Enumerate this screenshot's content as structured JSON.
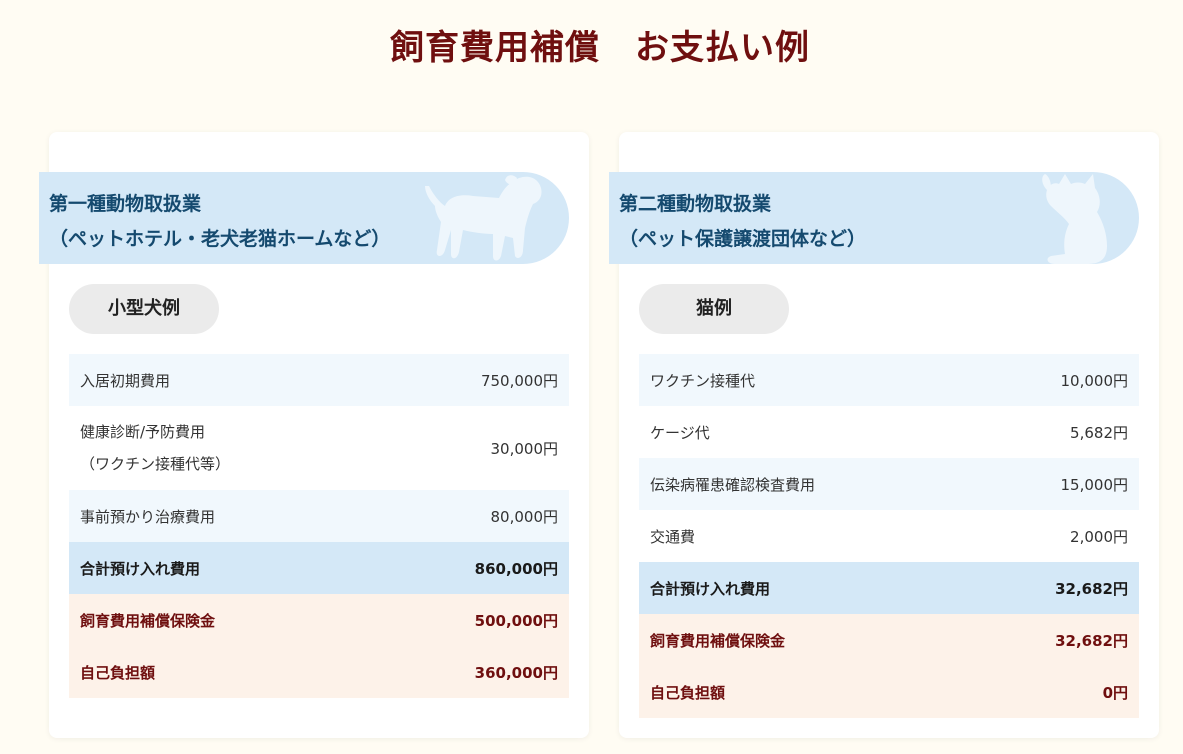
{
  "page": {
    "title": "飼育費用補償　お支払い例"
  },
  "colors": {
    "background": "#fffcf3",
    "title": "#6f0f0f",
    "banner": "#d4e8f7",
    "banner_text": "#154a6f",
    "row_alt": "#f1f8fd",
    "total_row": "#d4e8f7",
    "insured_row": "#fdf2e9"
  },
  "cards": [
    {
      "banner_line1": "第一種動物取扱業",
      "banner_line2": "（ペットホテル・老犬老猫ホームなど）",
      "banner_icon": "dog-silhouette-icon",
      "example_label": "小型犬例",
      "rows": [
        {
          "label": "入居初期費用",
          "value": "750,000円"
        },
        {
          "label": "健康診断/予防費用",
          "label2": "（ワクチン接種代等）",
          "value": "30,000円"
        },
        {
          "label": "事前預かり治療費用",
          "value": "80,000円"
        },
        {
          "label": "合計預け入れ費用",
          "value": "860,000円"
        },
        {
          "label": "飼育費用補償保険金",
          "value": "500,000円"
        },
        {
          "label": "自己負担額",
          "value": "360,000円"
        }
      ]
    },
    {
      "banner_line1": "第二種動物取扱業",
      "banner_line2": "（ペット保護譲渡団体など）",
      "banner_icon": "cat-silhouette-icon",
      "example_label": "猫例",
      "rows": [
        {
          "label": "ワクチン接種代",
          "value": "10,000円"
        },
        {
          "label": "ケージ代",
          "value": "5,682円"
        },
        {
          "label": "伝染病罹患確認検査費用",
          "value": "15,000円"
        },
        {
          "label": "交通費",
          "value": "2,000円"
        },
        {
          "label": "合計預け入れ費用",
          "value": "32,682円"
        },
        {
          "label": "飼育費用補償保険金",
          "value": "32,682円"
        },
        {
          "label": "自己負担額",
          "value": "0円"
        }
      ]
    }
  ]
}
